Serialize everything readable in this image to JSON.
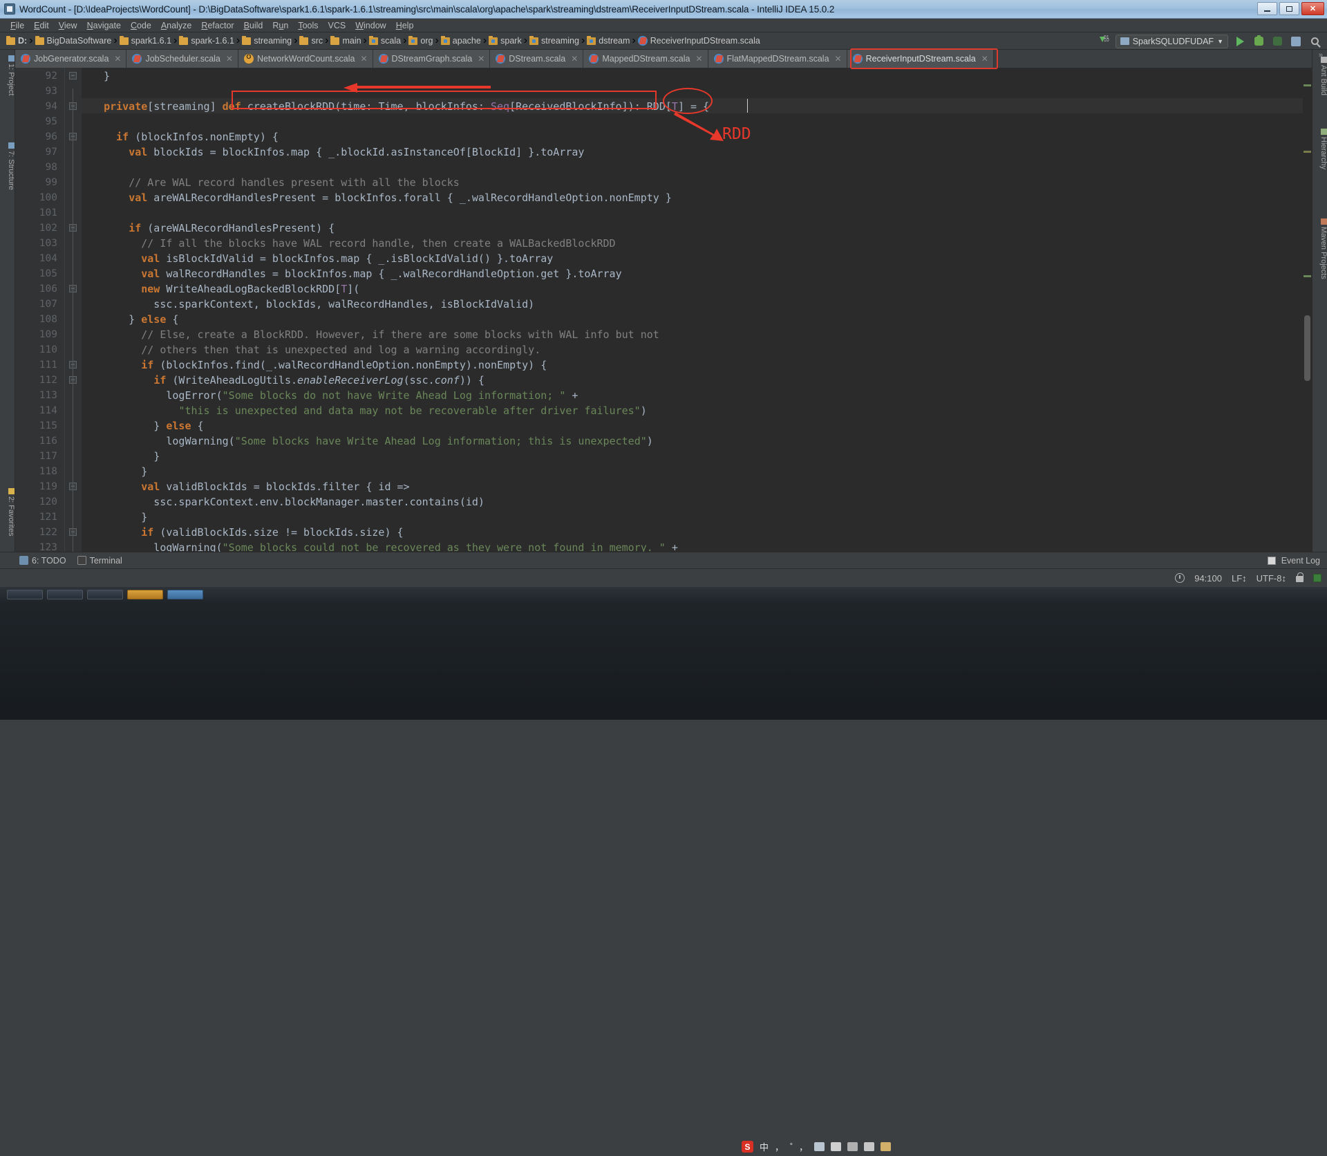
{
  "window": {
    "title": "WordCount - [D:\\IdeaProjects\\WordCount] - D:\\BigDataSoftware\\spark1.6.1\\spark-1.6.1\\streaming\\src\\main\\scala\\org\\apache\\spark\\streaming\\dstream\\ReceiverInputDStream.scala - IntelliJ IDEA 15.0.2",
    "app_icon": "intellij-idea-icon",
    "minimize_label": "–",
    "maximize_label": "❐",
    "close_label": "✕"
  },
  "menubar": {
    "items": [
      {
        "label": "File",
        "mnemonic": "F"
      },
      {
        "label": "Edit",
        "mnemonic": "E"
      },
      {
        "label": "View",
        "mnemonic": "V"
      },
      {
        "label": "Navigate",
        "mnemonic": "N"
      },
      {
        "label": "Code",
        "mnemonic": "C"
      },
      {
        "label": "Analyze",
        "mnemonic": "A"
      },
      {
        "label": "Refactor",
        "mnemonic": "R"
      },
      {
        "label": "Build",
        "mnemonic": "B"
      },
      {
        "label": "Run",
        "mnemonic": "u"
      },
      {
        "label": "Tools",
        "mnemonic": "T"
      },
      {
        "label": "VCS",
        "mnemonic": ""
      },
      {
        "label": "Window",
        "mnemonic": "W"
      },
      {
        "label": "Help",
        "mnemonic": "H"
      }
    ]
  },
  "navbar": {
    "crumbs": [
      {
        "label": "D:",
        "icon": "folder-icon"
      },
      {
        "label": "BigDataSoftware",
        "icon": "folder-icon"
      },
      {
        "label": "spark1.6.1",
        "icon": "folder-icon"
      },
      {
        "label": "spark-1.6.1",
        "icon": "folder-icon"
      },
      {
        "label": "streaming",
        "icon": "folder-icon"
      },
      {
        "label": "src",
        "icon": "folder-icon"
      },
      {
        "label": "main",
        "icon": "folder-icon"
      },
      {
        "label": "scala",
        "icon": "source-folder-icon"
      },
      {
        "label": "org",
        "icon": "package-icon"
      },
      {
        "label": "apache",
        "icon": "package-icon"
      },
      {
        "label": "spark",
        "icon": "package-icon"
      },
      {
        "label": "streaming",
        "icon": "package-icon"
      },
      {
        "label": "dstream",
        "icon": "package-icon"
      },
      {
        "label": "ReceiverInputDStream.scala",
        "icon": "scala-file-icon"
      }
    ],
    "separator": "›",
    "run_config": "SparkSQLUDFUDAF",
    "run_config_caret": "▼",
    "buttons": [
      {
        "name": "update-project-icon",
        "label": ""
      },
      {
        "name": "run-button",
        "label": ""
      },
      {
        "name": "debug-button",
        "label": ""
      },
      {
        "name": "run-with-coverage-button",
        "label": ""
      },
      {
        "name": "project-structure-button",
        "label": ""
      },
      {
        "name": "search-everywhere-icon",
        "label": ""
      }
    ]
  },
  "editor_tabs": {
    "items": [
      {
        "label": "JobGenerator.scala",
        "icon": "scala-file-icon",
        "active": false,
        "close": "✕"
      },
      {
        "label": "JobScheduler.scala",
        "icon": "scala-file-icon",
        "active": false,
        "close": "✕"
      },
      {
        "label": "NetworkWordCount.scala",
        "icon": "object-file-icon",
        "active": false,
        "close": "✕"
      },
      {
        "label": "DStreamGraph.scala",
        "icon": "scala-file-icon",
        "active": false,
        "close": "✕"
      },
      {
        "label": "DStream.scala",
        "icon": "scala-file-icon",
        "active": false,
        "close": "✕"
      },
      {
        "label": "MappedDStream.scala",
        "icon": "scala-file-icon",
        "active": false,
        "close": "✕"
      },
      {
        "label": "FlatMappedDStream.scala",
        "icon": "scala-file-icon",
        "active": false,
        "close": "✕"
      },
      {
        "label": "ReceiverInputDStream.scala",
        "icon": "scala-file-icon",
        "active": true,
        "close": "✕"
      }
    ],
    "overflow_label": "»"
  },
  "left_toolwindows": [
    {
      "label": "1: Project",
      "name": "sidebar-item-project"
    },
    {
      "label": "7: Structure",
      "name": "sidebar-item-structure"
    },
    {
      "label": "2: Favorites",
      "name": "sidebar-item-favorites"
    }
  ],
  "right_toolwindows": [
    {
      "label": "Ant Build",
      "name": "sidebar-item-ant-build"
    },
    {
      "label": "Hierarchy",
      "name": "sidebar-item-hierarchy"
    },
    {
      "label": "Maven Projects",
      "name": "sidebar-item-maven-projects"
    }
  ],
  "code": {
    "first_line": 92,
    "caret_line": 94,
    "lines": [
      {
        "n": 92,
        "indent": 0,
        "fold": "minus",
        "tokens": [
          {
            "t": "  }",
            "c": "p"
          }
        ]
      },
      {
        "n": 93,
        "indent": 0,
        "fold": "",
        "tokens": []
      },
      {
        "n": 94,
        "indent": 0,
        "fold": "minus",
        "tokens": [
          {
            "t": "  ",
            "c": "p"
          },
          {
            "t": "private",
            "c": "k"
          },
          {
            "t": "[streaming] ",
            "c": "p"
          },
          {
            "t": "def",
            "c": "k"
          },
          {
            "t": " createBlockRDD(time: ",
            "c": "p"
          },
          {
            "t": "Time",
            "c": "p"
          },
          {
            "t": ", blockInfos: ",
            "c": "p"
          },
          {
            "t": "Seq",
            "c": "t"
          },
          {
            "t": "[ReceivedBlockInfo]): ",
            "c": "p"
          },
          {
            "t": "RDD",
            "c": "p"
          },
          {
            "t": "[",
            "c": "p"
          },
          {
            "t": "T",
            "c": "t"
          },
          {
            "t": "] = {",
            "c": "p"
          }
        ]
      },
      {
        "n": 95,
        "indent": 0,
        "fold": "",
        "tokens": []
      },
      {
        "n": 96,
        "indent": 0,
        "fold": "minus",
        "tokens": [
          {
            "t": "    ",
            "c": "p"
          },
          {
            "t": "if",
            "c": "k"
          },
          {
            "t": " (blockInfos.nonEmpty) {",
            "c": "p"
          }
        ]
      },
      {
        "n": 97,
        "indent": 0,
        "fold": "",
        "tokens": [
          {
            "t": "      ",
            "c": "p"
          },
          {
            "t": "val",
            "c": "k"
          },
          {
            "t": " blockIds = blockInfos.map { _.blockId.asInstanceOf[BlockId] }.toArray",
            "c": "p"
          }
        ]
      },
      {
        "n": 98,
        "indent": 0,
        "fold": "",
        "tokens": []
      },
      {
        "n": 99,
        "indent": 0,
        "fold": "",
        "tokens": [
          {
            "t": "      ",
            "c": "p"
          },
          {
            "t": "// Are WAL record handles present with all the blocks",
            "c": "c"
          }
        ]
      },
      {
        "n": 100,
        "indent": 0,
        "fold": "",
        "tokens": [
          {
            "t": "      ",
            "c": "p"
          },
          {
            "t": "val",
            "c": "k"
          },
          {
            "t": " areWALRecordHandlesPresent = blockInfos.forall { _.walRecordHandleOption.nonEmpty }",
            "c": "p"
          }
        ]
      },
      {
        "n": 101,
        "indent": 0,
        "fold": "",
        "tokens": []
      },
      {
        "n": 102,
        "indent": 0,
        "fold": "minus",
        "tokens": [
          {
            "t": "      ",
            "c": "p"
          },
          {
            "t": "if",
            "c": "k"
          },
          {
            "t": " (areWALRecordHandlesPresent) {",
            "c": "p"
          }
        ]
      },
      {
        "n": 103,
        "indent": 0,
        "fold": "",
        "tokens": [
          {
            "t": "        ",
            "c": "p"
          },
          {
            "t": "// If all the blocks have WAL record handle, then create a WALBackedBlockRDD",
            "c": "c"
          }
        ]
      },
      {
        "n": 104,
        "indent": 0,
        "fold": "",
        "tokens": [
          {
            "t": "        ",
            "c": "p"
          },
          {
            "t": "val",
            "c": "k"
          },
          {
            "t": " isBlockIdValid = blockInfos.map { _.isBlockIdValid() }.toArray",
            "c": "p"
          }
        ]
      },
      {
        "n": 105,
        "indent": 0,
        "fold": "",
        "tokens": [
          {
            "t": "        ",
            "c": "p"
          },
          {
            "t": "val",
            "c": "k"
          },
          {
            "t": " walRecordHandles = blockInfos.map { _.walRecordHandleOption.get }.toArray",
            "c": "p"
          }
        ]
      },
      {
        "n": 106,
        "indent": 0,
        "fold": "minus",
        "tokens": [
          {
            "t": "        ",
            "c": "p"
          },
          {
            "t": "new",
            "c": "k"
          },
          {
            "t": " WriteAheadLogBackedBlockRDD[",
            "c": "p"
          },
          {
            "t": "T",
            "c": "t"
          },
          {
            "t": "](",
            "c": "p"
          }
        ]
      },
      {
        "n": 107,
        "indent": 0,
        "fold": "",
        "tokens": [
          {
            "t": "          ssc.sparkContext, blockIds, walRecordHandles, isBlockIdValid)",
            "c": "p"
          }
        ]
      },
      {
        "n": 108,
        "indent": 0,
        "fold": "",
        "tokens": [
          {
            "t": "      } ",
            "c": "p"
          },
          {
            "t": "else",
            "c": "k"
          },
          {
            "t": " {",
            "c": "p"
          }
        ]
      },
      {
        "n": 109,
        "indent": 0,
        "fold": "",
        "tokens": [
          {
            "t": "        ",
            "c": "p"
          },
          {
            "t": "// Else, create a BlockRDD. However, if there are some blocks with WAL info but not",
            "c": "c"
          }
        ]
      },
      {
        "n": 110,
        "indent": 0,
        "fold": "",
        "tokens": [
          {
            "t": "        ",
            "c": "p"
          },
          {
            "t": "// others then that is unexpected and log a warning accordingly.",
            "c": "c"
          }
        ]
      },
      {
        "n": 111,
        "indent": 0,
        "fold": "minus",
        "tokens": [
          {
            "t": "        ",
            "c": "p"
          },
          {
            "t": "if",
            "c": "k"
          },
          {
            "t": " (blockInfos.find(_.walRecordHandleOption.nonEmpty).nonEmpty) {",
            "c": "p"
          }
        ]
      },
      {
        "n": 112,
        "indent": 0,
        "fold": "minus",
        "tokens": [
          {
            "t": "          ",
            "c": "p"
          },
          {
            "t": "if",
            "c": "k"
          },
          {
            "t": " (WriteAheadLogUtils.",
            "c": "p"
          },
          {
            "t": "enableReceiverLog",
            "c": "it"
          },
          {
            "t": "(ssc.",
            "c": "p"
          },
          {
            "t": "conf",
            "c": "it"
          },
          {
            "t": ")) {",
            "c": "p"
          }
        ]
      },
      {
        "n": 113,
        "indent": 0,
        "fold": "",
        "tokens": [
          {
            "t": "            logError(",
            "c": "p"
          },
          {
            "t": "\"Some blocks do not have Write Ahead Log information; \"",
            "c": "s"
          },
          {
            "t": " +",
            "c": "p"
          }
        ]
      },
      {
        "n": 114,
        "indent": 0,
        "fold": "",
        "tokens": [
          {
            "t": "              ",
            "c": "p"
          },
          {
            "t": "\"this is unexpected and data may not be recoverable after driver failures\"",
            "c": "s"
          },
          {
            "t": ")",
            "c": "p"
          }
        ]
      },
      {
        "n": 115,
        "indent": 0,
        "fold": "",
        "tokens": [
          {
            "t": "          } ",
            "c": "p"
          },
          {
            "t": "else",
            "c": "k"
          },
          {
            "t": " {",
            "c": "p"
          }
        ]
      },
      {
        "n": 116,
        "indent": 0,
        "fold": "",
        "tokens": [
          {
            "t": "            logWarning(",
            "c": "p"
          },
          {
            "t": "\"Some blocks have Write Ahead Log information; this is unexpected\"",
            "c": "s"
          },
          {
            "t": ")",
            "c": "p"
          }
        ]
      },
      {
        "n": 117,
        "indent": 0,
        "fold": "",
        "tokens": [
          {
            "t": "          }",
            "c": "p"
          }
        ]
      },
      {
        "n": 118,
        "indent": 0,
        "fold": "",
        "tokens": [
          {
            "t": "        }",
            "c": "p"
          }
        ]
      },
      {
        "n": 119,
        "indent": 0,
        "fold": "minus",
        "tokens": [
          {
            "t": "        ",
            "c": "p"
          },
          {
            "t": "val",
            "c": "k"
          },
          {
            "t": " validBlockIds = blockIds.",
            "c": "p"
          },
          {
            "t": "filter",
            "c": "p"
          },
          {
            "t": " { id =>",
            "c": "p"
          }
        ]
      },
      {
        "n": 120,
        "indent": 0,
        "fold": "",
        "tokens": [
          {
            "t": "          ssc.sparkContext.env.blockManager.master.contains(id)",
            "c": "p"
          }
        ]
      },
      {
        "n": 121,
        "indent": 0,
        "fold": "",
        "tokens": [
          {
            "t": "        }",
            "c": "p"
          }
        ]
      },
      {
        "n": 122,
        "indent": 0,
        "fold": "minus",
        "tokens": [
          {
            "t": "        ",
            "c": "p"
          },
          {
            "t": "if",
            "c": "k"
          },
          {
            "t": " (validBlockIds.size != blockIds.size) {",
            "c": "p"
          }
        ]
      },
      {
        "n": 123,
        "indent": 0,
        "fold": "",
        "tokens": [
          {
            "t": "          logWarning(",
            "c": "p"
          },
          {
            "t": "\"Some blocks could not be recovered as they were not found in memory. \"",
            "c": "s"
          },
          {
            "t": " +",
            "c": "p"
          }
        ]
      }
    ]
  },
  "annotations": {
    "rdd_label": "RDD",
    "color": "#e8382b",
    "shapes": [
      "method-signature-rectangle",
      "left-arrow",
      "rdd-ellipse",
      "diagonal-arrow",
      "rdd-text"
    ]
  },
  "bottom_bar": {
    "todo_label": "6: TODO",
    "todo_number": "6",
    "terminal_label": "Terminal",
    "event_log_label": "Event Log"
  },
  "status_bar": {
    "caret_position": "94:100",
    "line_separator": "LF↕",
    "encoding": "UTF-8↕",
    "lock_icon": "read-only-lock-icon",
    "clock_icon": "clock-icon",
    "ime": {
      "sogou_label": "S",
      "mode_label": "中",
      "punct_label": "，",
      "shape_label": "゜，",
      "keyboard_icon": "keyboard-icon",
      "toolbox_icon": "toolbox-icon",
      "umbrella_icon": "umbrella-icon",
      "box_icon": "box-icon",
      "pencil_icon": "pencil-icon"
    }
  },
  "colors": {
    "accent_red": "#e8382b",
    "keyword": "#cc7832",
    "string": "#6a8759",
    "comment": "#808080",
    "type": "#9876aa",
    "editor_bg": "#2b2b2b",
    "chrome_bg": "#3c3f41"
  }
}
